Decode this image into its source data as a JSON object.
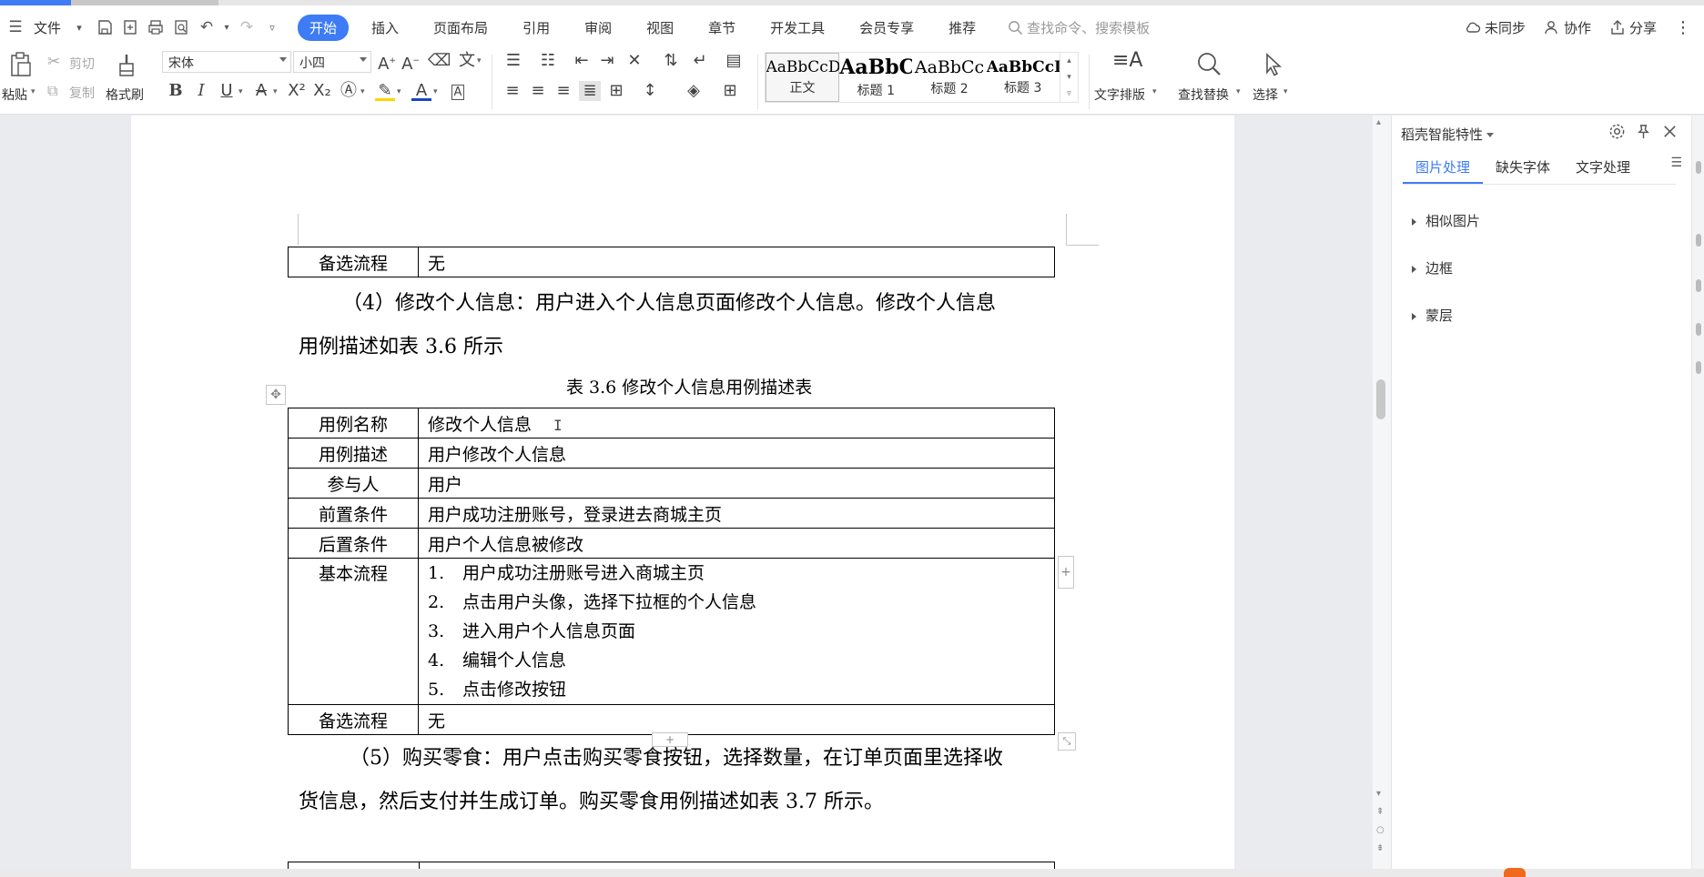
{
  "menu": {
    "file": "文件",
    "tabs": [
      "开始",
      "插入",
      "页面布局",
      "引用",
      "审阅",
      "视图",
      "章节",
      "开发工具",
      "会员专享",
      "推荐"
    ],
    "active_tab": "开始",
    "search_placeholder": "查找命令、搜索模板",
    "right": {
      "sync": "未同步",
      "collab": "协作",
      "share": "分享"
    }
  },
  "ribbon": {
    "paste": "粘贴",
    "cut": "剪切",
    "copy": "复制",
    "format_painter": "格式刷",
    "font": "宋体",
    "font_size": "小四",
    "styles": [
      {
        "preview": "AaBbCcDd",
        "name": "正文"
      },
      {
        "preview": "AaBbC",
        "name": "标题 1"
      },
      {
        "preview": "AaBbCc",
        "name": "标题 2"
      },
      {
        "preview": "AaBbCcI",
        "name": "标题 3"
      }
    ],
    "text_layout": "文字排版",
    "find_replace": "查找替换",
    "select": "选择"
  },
  "document": {
    "prev_table_last": {
      "key": "备选流程",
      "value": "无"
    },
    "para4": {
      "line1": "（4）修改个人信息：用户进入个人信息页面修改个人信息。修改个人信息",
      "line2": "用例描述如表 3.6 所示"
    },
    "table_caption": "表 3.6  修改个人信息用例描述表",
    "table": [
      {
        "key": "用例名称",
        "value": "修改个人信息"
      },
      {
        "key": "用例描述",
        "value": "用户修改个人信息"
      },
      {
        "key": "参与人",
        "value": "用户"
      },
      {
        "key": "前置条件",
        "value": "用户成功注册账号，登录进去商城主页"
      },
      {
        "key": "后置条件",
        "value": "用户个人信息被修改"
      }
    ],
    "basic_flow_key": "基本流程",
    "basic_flow": [
      {
        "n": "1.",
        "text": "用户成功注册账号进入商城主页"
      },
      {
        "n": "2.",
        "text": "点击用户头像，选择下拉框的个人信息"
      },
      {
        "n": "3.",
        "text": "进入用户个人信息页面"
      },
      {
        "n": "4.",
        "text": "编辑个人信息"
      },
      {
        "n": "5.",
        "text": "点击修改按钮"
      }
    ],
    "alt_flow": {
      "key": "备选流程",
      "value": "无"
    },
    "para5": {
      "line1": "（5）购买零食：用户点击购买零食按钮，选择数量，在订单页面里选择收",
      "line2": "货信息，然后支付并生成订单。购买零食用例描述如表 3.7 所示。"
    }
  },
  "panel": {
    "title": "稻壳智能特性",
    "tabs": [
      "图片处理",
      "缺失字体",
      "文字处理"
    ],
    "active_tab": "图片处理",
    "items": [
      "相似图片",
      "边框",
      "蒙层"
    ]
  }
}
